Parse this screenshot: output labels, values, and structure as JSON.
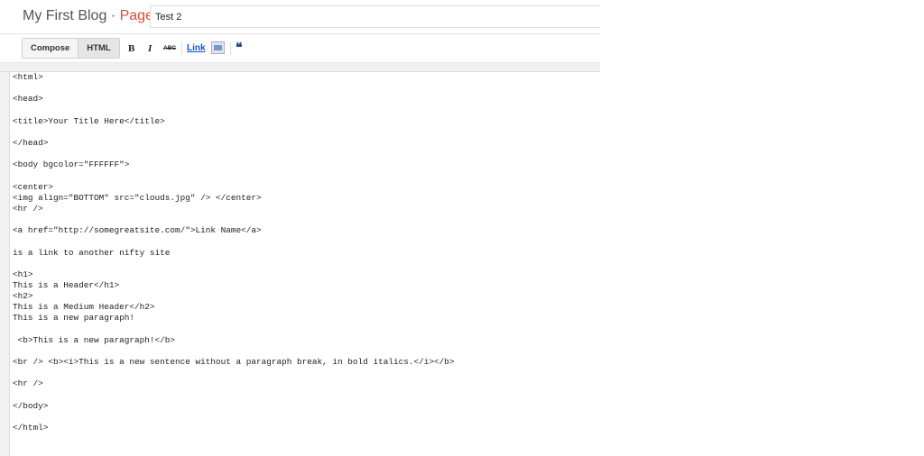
{
  "header": {
    "blog_name": "My First Blog",
    "separator": " · ",
    "type_label": "Page",
    "post_title": "Test 2"
  },
  "toolbar": {
    "modes": [
      "Compose",
      "HTML"
    ],
    "active_mode": "HTML",
    "bold_label": "B",
    "italic_label": "I",
    "strike_label": "ABC",
    "link_label": "Link",
    "quote_label": "❝"
  },
  "editor": {
    "content": "<html>\n\n<head>\n\n<title>Your Title Here</title>\n\n</head>\n\n<body bgcolor=\"FFFFFF\">\n\n<center>\n<img align=\"BOTTOM\" src=\"clouds.jpg\" /> </center>\n<hr />\n\n<a href=\"http://somegreatsite.com/\">Link Name</a>\n\nis a link to another nifty site\n\n<h1>\nThis is a Header</h1>\n<h2>\nThis is a Medium Header</h2>\nThis is a new paragraph!\n\n <b>This is a new paragraph!</b>\n\n<br /> <b><i>This is a new sentence without a paragraph break, in bold italics.</i></b>\n\n<hr />\n\n</body>\n\n</html>"
  }
}
